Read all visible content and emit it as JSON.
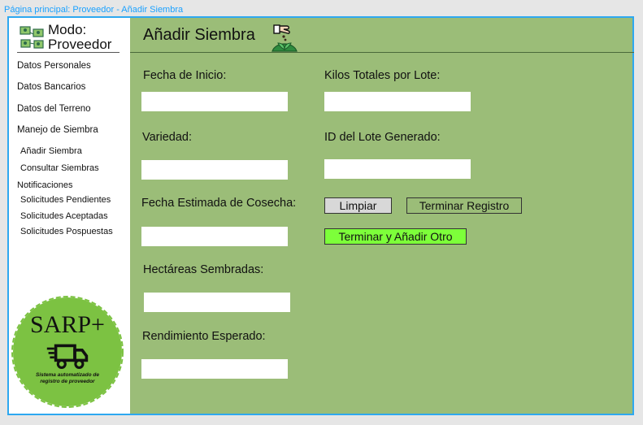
{
  "breadcrumb": "Página principal: Proveedor - Añadir Siembra",
  "sidebar": {
    "mode_line1": "Modo:",
    "mode_line2": "Proveedor",
    "items": [
      {
        "label": "Datos Personales"
      },
      {
        "label": "Datos Bancarios"
      },
      {
        "label": "Datos del Terreno"
      },
      {
        "label": "Manejo de Siembra"
      },
      {
        "label": "Añadir Siembra"
      },
      {
        "label": "Consultar Siembras"
      },
      {
        "label": "Notificaciones"
      },
      {
        "label": "Solicitudes Pendientes"
      },
      {
        "label": "Solicitudes Aceptadas"
      },
      {
        "label": "Solicitudes Pospuestas"
      }
    ],
    "logo": {
      "title": "SARP+",
      "subtitle_line1": "Sistema automatizado de",
      "subtitle_line2": "registro de proveedor",
      "color": "#7cc242"
    }
  },
  "header": {
    "title": "Añadir Siembra"
  },
  "form": {
    "fecha_inicio": {
      "label": "Fecha de Inicio:",
      "value": ""
    },
    "variedad": {
      "label": "Variedad:",
      "value": ""
    },
    "fecha_cosecha": {
      "label": "Fecha Estimada de Cosecha:",
      "value": ""
    },
    "hectareas": {
      "label": "Hectáreas Sembradas:",
      "value": ""
    },
    "rendimiento": {
      "label": "Rendimiento Esperado:",
      "value": ""
    },
    "kilos": {
      "label": "Kilos Totales por Lote:",
      "value": ""
    },
    "id_lote": {
      "label": "ID del Lote Generado:",
      "value": ""
    }
  },
  "buttons": {
    "limpiar": "Limpiar",
    "terminar_registro": "Terminar Registro",
    "terminar_anadir": "Terminar y Añadir Otro"
  },
  "colors": {
    "panel_bg": "#9bbd78",
    "frame_border": "#2ea8f0",
    "accent_button": "#7dff3a"
  }
}
